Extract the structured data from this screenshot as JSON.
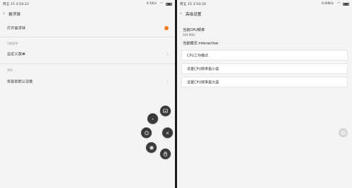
{
  "left": {
    "status": {
      "time": "周五 15 3:54:22",
      "speed": "0.1K/s"
    },
    "title": "悬浮球",
    "toggle_label": "打开悬浮球",
    "section_menu": "功能菜单",
    "custom_menu": "自定义菜单",
    "section_other": "其他",
    "restore": "恢复到默认设置"
  },
  "right": {
    "status": {
      "time": "周五 15 3:54:34",
      "speed": "0.00K/s"
    },
    "title": "高级设置",
    "freq_label": "当前CPU频率",
    "freq_value": "204 MHz",
    "mode_label": "当前模式 interactive",
    "items": [
      {
        "label": "CPU工作模式"
      },
      {
        "label": "设置CPU频率最小值"
      },
      {
        "label": "设置CPU频率最大值"
      }
    ]
  },
  "icons": {
    "back": "‹",
    "chevron": "›",
    "float_back": "‹",
    "float_close": "×"
  },
  "colors": {
    "accent": "#ff7a1a",
    "float_button": "#3a3a3a"
  }
}
